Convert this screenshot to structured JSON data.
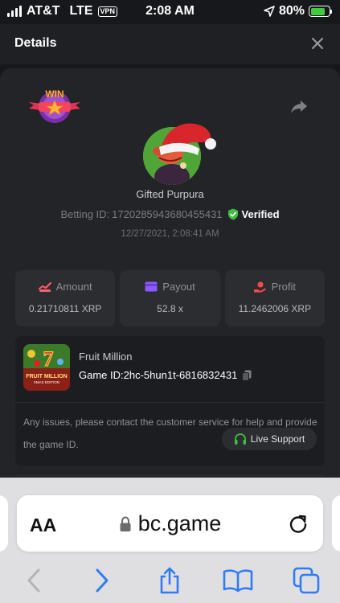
{
  "status_bar": {
    "carrier": "AT&T",
    "network": "LTE",
    "vpn": "VPN",
    "time": "2:08 AM",
    "battery": "80%",
    "battery_level": 0.8
  },
  "header": {
    "title": "Details"
  },
  "bet": {
    "win_badge": "WIN",
    "username": "Gifted Purpura",
    "betting_id_label": "Betting ID:",
    "betting_id": "1720285943680455431",
    "verified": "Verified",
    "timestamp": "12/27/2021, 2:08:41 AM"
  },
  "stats": {
    "amount_label": "Amount",
    "amount_value": "0.21710811 XRP",
    "payout_label": "Payout",
    "payout_value": "52.8 x",
    "profit_label": "Profit",
    "profit_value": "11.2462006 XRP"
  },
  "game": {
    "name": "Fruit Million",
    "game_id_label": "Game ID:",
    "game_id": "2hc-5hun1t-6816832431",
    "thumb_title": "FRUIT MILLION",
    "thumb_subtitle": "XMAS EDITION",
    "help_text": "Any issues, please contact the customer service for help and provide the game ID.",
    "live_support": "Live Support"
  },
  "browser": {
    "text_size": "AA",
    "url": "bc.game"
  },
  "colors": {
    "background": "#17181b",
    "card": "#232427",
    "verified_green": "#3fbf3f",
    "amount_icon": "#ff5e6e",
    "payout_icon": "#8a5cff",
    "profit_icon": "#ff4a4a",
    "support_icon": "#3fbf3f",
    "safari_blue": "#2f7cf6"
  }
}
